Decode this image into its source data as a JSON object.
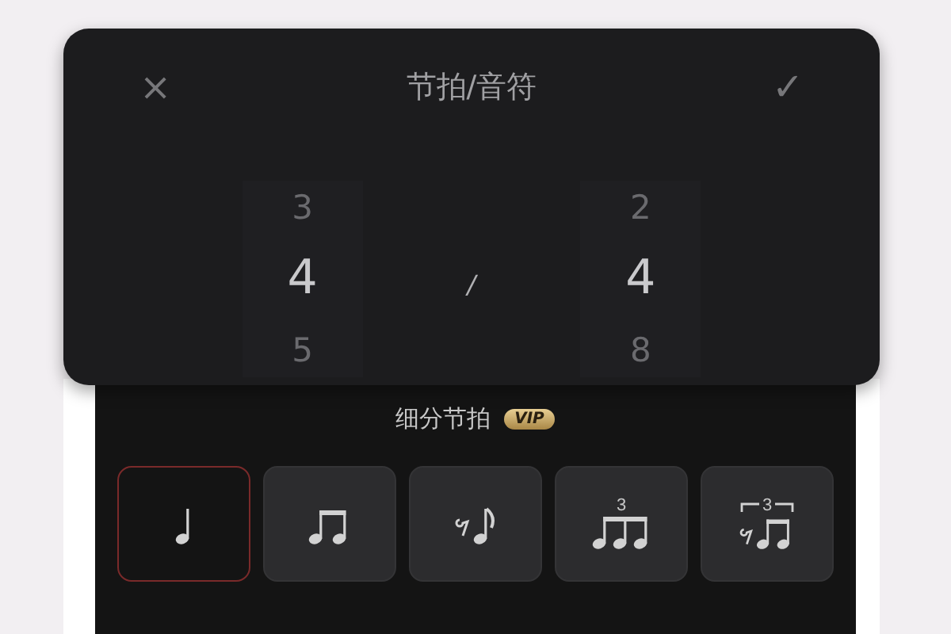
{
  "sheet": {
    "title": "节拍/音符",
    "close": "×",
    "confirm": "✓"
  },
  "picker": {
    "separator": "/",
    "columns": [
      {
        "items": [
          {
            "label": "3",
            "selected": false
          },
          {
            "label": "4",
            "selected": true
          },
          {
            "label": "5",
            "selected": false
          }
        ]
      },
      {
        "items": [
          {
            "label": "2",
            "selected": false
          },
          {
            "label": "4",
            "selected": true
          },
          {
            "label": "8",
            "selected": false
          }
        ]
      }
    ]
  },
  "subdivision": {
    "title": "细分节拍",
    "badge": "VIP",
    "options": [
      {
        "kind": "quarter",
        "selected": true
      },
      {
        "kind": "eighths",
        "selected": false
      },
      {
        "kind": "rest-eighth",
        "selected": false
      },
      {
        "kind": "triplet",
        "tuplet": "3",
        "selected": false
      },
      {
        "kind": "rest-triplet",
        "tuplet": "3",
        "selected": false
      }
    ]
  }
}
